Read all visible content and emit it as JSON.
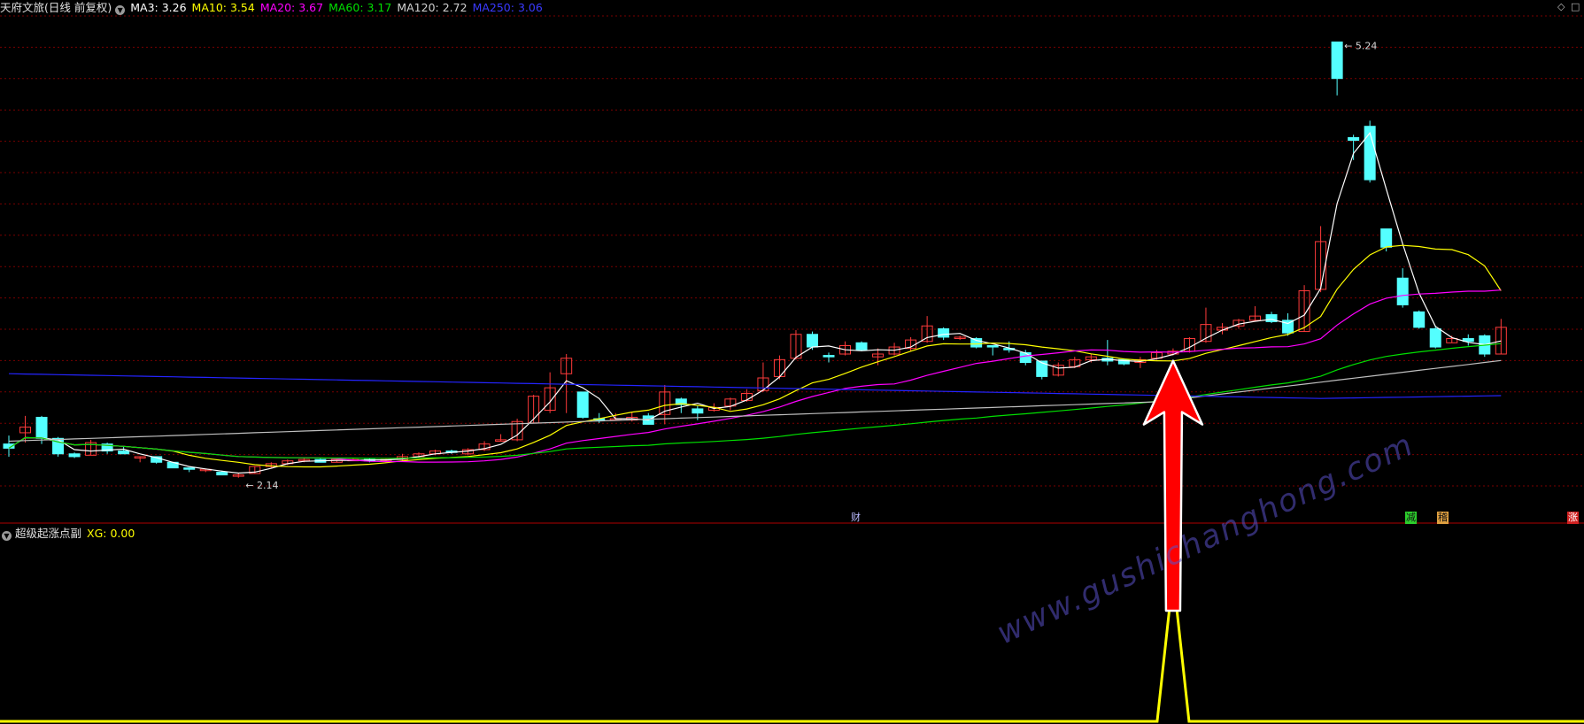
{
  "header": {
    "stock_name": "天府文旅(日线 前复权)",
    "ma3": "MA3: 3.26",
    "ma10": "MA10: 3.54",
    "ma20": "MA20: 3.67",
    "ma60": "MA60: 3.17",
    "ma120": "MA120: 2.72",
    "ma250": "MA250: 3.06"
  },
  "sub_header": {
    "indicator_name": "超级起涨点副",
    "xg": "XG: 0.00"
  },
  "tags": {
    "cai": "财",
    "jian": "减",
    "ji": "稽",
    "zhang": "涨"
  },
  "watermark": "www.gushichanghong.com",
  "colors": {
    "background": "#000000",
    "up_candle": "#ff3b3b",
    "down_candle": "#54ffff",
    "ma3": "#ffffff",
    "ma10": "#ffff00",
    "ma20": "#ff00ff",
    "ma60": "#00e000",
    "ma120": "#bfbfbf",
    "ma250": "#2424ff",
    "grid": "#7a0000",
    "signal_line": "#ffff00",
    "arrow": "#ff0000"
  },
  "chart_data": {
    "type": "candlestick",
    "price_annotations": [
      {
        "text": "5.24",
        "value": 5.24
      },
      {
        "text": "2.14",
        "value": 2.14
      }
    ],
    "ylim": [
      2.0,
      5.4
    ],
    "grid": true,
    "candles": [
      [
        2.38,
        2.35,
        2.44,
        2.29
      ],
      [
        2.46,
        2.5,
        2.58,
        2.39
      ],
      [
        2.57,
        2.42,
        2.58,
        2.38
      ],
      [
        2.42,
        2.31,
        2.43,
        2.29
      ],
      [
        2.31,
        2.29,
        2.32,
        2.28
      ],
      [
        2.3,
        2.39,
        2.41,
        2.3
      ],
      [
        2.38,
        2.33,
        2.39,
        2.31
      ],
      [
        2.33,
        2.31,
        2.36,
        2.31
      ],
      [
        2.28,
        2.29,
        2.29,
        2.25
      ],
      [
        2.29,
        2.25,
        2.29,
        2.24
      ],
      [
        2.25,
        2.21,
        2.25,
        2.21
      ],
      [
        2.21,
        2.2,
        2.21,
        2.18
      ],
      [
        2.2,
        2.2,
        2.2,
        2.18
      ],
      [
        2.18,
        2.16,
        2.19,
        2.16
      ],
      [
        2.16,
        2.16,
        2.17,
        2.14
      ],
      [
        2.17,
        2.22,
        2.22,
        2.17
      ],
      [
        2.22,
        2.24,
        2.25,
        2.21
      ],
      [
        2.24,
        2.26,
        2.27,
        2.23
      ],
      [
        2.26,
        2.27,
        2.28,
        2.25
      ],
      [
        2.27,
        2.25,
        2.28,
        2.25
      ],
      [
        2.25,
        2.27,
        2.28,
        2.25
      ],
      [
        2.27,
        2.27,
        2.28,
        2.26
      ],
      [
        2.27,
        2.26,
        2.28,
        2.25
      ],
      [
        2.26,
        2.27,
        2.28,
        2.25
      ],
      [
        2.27,
        2.29,
        2.31,
        2.26
      ],
      [
        2.29,
        2.31,
        2.32,
        2.28
      ],
      [
        2.31,
        2.33,
        2.34,
        2.3
      ],
      [
        2.33,
        2.32,
        2.34,
        2.31
      ],
      [
        2.31,
        2.34,
        2.35,
        2.3
      ],
      [
        2.34,
        2.38,
        2.4,
        2.33
      ],
      [
        2.4,
        2.41,
        2.45,
        2.4
      ],
      [
        2.41,
        2.54,
        2.56,
        2.4
      ],
      [
        2.53,
        2.72,
        2.73,
        2.53
      ],
      [
        2.62,
        2.78,
        2.89,
        2.6
      ],
      [
        2.88,
        2.99,
        3.02,
        2.6
      ],
      [
        2.75,
        2.57,
        2.75,
        2.56
      ],
      [
        2.56,
        2.55,
        2.6,
        2.53
      ],
      [
        2.56,
        2.56,
        2.6,
        2.55
      ],
      [
        2.55,
        2.57,
        2.61,
        2.54
      ],
      [
        2.58,
        2.52,
        2.6,
        2.52
      ],
      [
        2.59,
        2.75,
        2.8,
        2.52
      ],
      [
        2.7,
        2.66,
        2.71,
        2.6
      ],
      [
        2.63,
        2.6,
        2.65,
        2.55
      ],
      [
        2.62,
        2.64,
        2.67,
        2.61
      ],
      [
        2.65,
        2.7,
        2.71,
        2.62
      ],
      [
        2.69,
        2.74,
        2.77,
        2.68
      ],
      [
        2.76,
        2.85,
        2.96,
        2.75
      ],
      [
        2.86,
        2.98,
        3.01,
        2.84
      ],
      [
        2.99,
        3.16,
        3.19,
        2.98
      ],
      [
        3.16,
        3.07,
        3.18,
        3.05
      ],
      [
        3.01,
        3.0,
        3.03,
        2.96
      ],
      [
        3.02,
        3.08,
        3.11,
        3.01
      ],
      [
        3.1,
        3.05,
        3.11,
        3.04
      ],
      [
        3.0,
        3.02,
        3.06,
        2.94
      ],
      [
        3.02,
        3.07,
        3.1,
        3.01
      ],
      [
        3.06,
        3.12,
        3.14,
        3.04
      ],
      [
        3.11,
        3.22,
        3.29,
        3.1
      ],
      [
        3.2,
        3.14,
        3.21,
        3.12
      ],
      [
        3.13,
        3.14,
        3.15,
        3.12
      ],
      [
        3.13,
        3.07,
        3.14,
        3.06
      ],
      [
        3.08,
        3.07,
        3.08,
        3.01
      ],
      [
        3.06,
        3.05,
        3.11,
        3.03
      ],
      [
        3.03,
        2.96,
        3.05,
        2.94
      ],
      [
        2.97,
        2.86,
        2.97,
        2.84
      ],
      [
        2.87,
        2.94,
        2.96,
        2.86
      ],
      [
        2.93,
        2.98,
        3.0,
        2.92
      ],
      [
        2.98,
        3.0,
        3.02,
        2.96
      ],
      [
        2.99,
        2.97,
        3.12,
        2.94
      ],
      [
        2.98,
        2.95,
        2.99,
        2.94
      ],
      [
        2.96,
        2.98,
        3.0,
        2.92
      ],
      [
        2.99,
        3.03,
        3.05,
        2.98
      ],
      [
        3.02,
        3.04,
        3.06,
        3.01
      ],
      [
        3.04,
        3.13,
        3.14,
        3.03
      ],
      [
        3.11,
        3.23,
        3.35,
        3.1
      ],
      [
        3.19,
        3.21,
        3.24,
        3.16
      ],
      [
        3.22,
        3.26,
        3.27,
        3.2
      ],
      [
        3.26,
        3.29,
        3.36,
        3.25
      ],
      [
        3.3,
        3.25,
        3.32,
        3.24
      ],
      [
        3.26,
        3.17,
        3.31,
        3.15
      ],
      [
        3.18,
        3.47,
        3.51,
        3.18
      ],
      [
        3.48,
        3.82,
        3.93,
        3.46
      ],
      [
        5.24,
        4.98,
        5.24,
        4.86
      ],
      [
        4.56,
        4.54,
        4.58,
        4.4
      ],
      [
        4.64,
        4.26,
        4.68,
        4.24
      ],
      [
        3.91,
        3.78,
        3.91,
        3.75
      ],
      [
        3.56,
        3.37,
        3.63,
        3.35
      ],
      [
        3.32,
        3.21,
        3.33,
        3.2
      ],
      [
        3.2,
        3.07,
        3.22,
        3.06
      ],
      [
        3.1,
        3.13,
        3.15,
        3.1
      ],
      [
        3.13,
        3.11,
        3.16,
        3.08
      ],
      [
        3.15,
        3.02,
        3.16,
        3.0
      ],
      [
        3.02,
        3.21,
        3.27,
        3.02
      ]
    ],
    "series": [
      {
        "name": "MA3",
        "values": []
      },
      {
        "name": "MA10",
        "values": []
      },
      {
        "name": "MA20",
        "values": []
      },
      {
        "name": "MA60",
        "values": []
      },
      {
        "name": "MA120",
        "values": []
      },
      {
        "name": "MA250",
        "values": []
      }
    ],
    "signal": {
      "name": "XG",
      "spike_index": 71,
      "value": 0.0
    }
  }
}
